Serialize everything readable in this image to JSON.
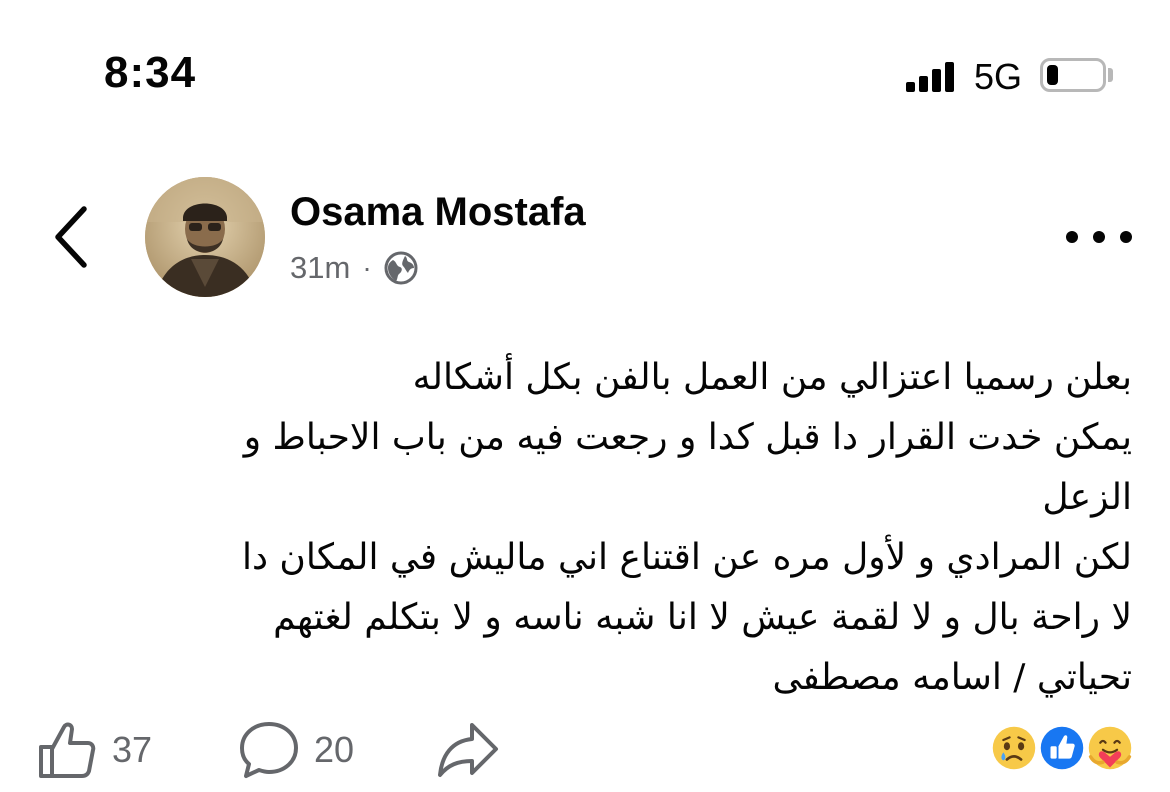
{
  "status_bar": {
    "time": "8:34",
    "network": "5G",
    "battery_level": 0.2,
    "icons": [
      "signal-icon",
      "battery-icon"
    ]
  },
  "post": {
    "author": "Osama Mostafa",
    "time_ago": "31m",
    "dot": "·",
    "audience_icon": "globe-icon",
    "lines": [
      "بعلن رسميا اعتزالي من العمل بالفن بكل أشكاله",
      "يمكن خدت القرار دا قبل كدا و رجعت فيه من باب الاحباط و",
      "الزعل",
      "لكن المرادي و لأول مره عن اقتناع اني ماليش في المكان دا",
      "لا راحة بال و لا لقمة عيش لا انا شبه ناسه و لا بتكلم لغتهم",
      "تحياتي / اسامه مصطفى"
    ]
  },
  "actions": {
    "like_count": "37",
    "comment_count": "20"
  },
  "reactions": [
    "sad-reaction-icon",
    "like-reaction-icon",
    "care-reaction-icon"
  ],
  "colors": {
    "text": "#050505",
    "meta": "#65676b",
    "like_blue": "#1877f2",
    "reaction_yellow": "#f7c948"
  }
}
